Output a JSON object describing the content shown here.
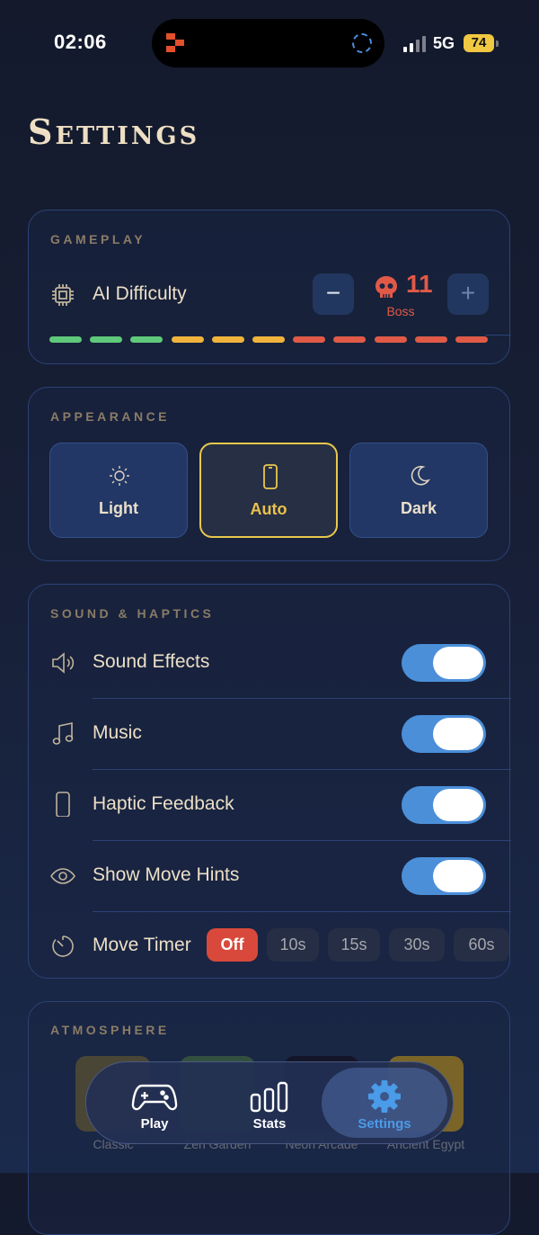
{
  "status_bar": {
    "time": "02:06",
    "network": "5G",
    "battery": "74"
  },
  "page": {
    "title": "Settings"
  },
  "gameplay": {
    "section_label": "GAMEPLAY",
    "ai_difficulty_label": "AI Difficulty",
    "minus_label": "−",
    "plus_label": "+",
    "value": "11",
    "tier": "Boss",
    "scale_colors": [
      "#5fc97b",
      "#5fc97b",
      "#5fc97b",
      "#f0b43c",
      "#f0b43c",
      "#f0b43c",
      "#e05a47",
      "#e05a47",
      "#e05a47",
      "#e05a47",
      "#e05a47"
    ]
  },
  "appearance": {
    "section_label": "APPEARANCE",
    "options": [
      {
        "label": "Light",
        "icon": "sun-icon",
        "selected": false
      },
      {
        "label": "Auto",
        "icon": "phone-icon",
        "selected": true
      },
      {
        "label": "Dark",
        "icon": "moon-icon",
        "selected": false
      }
    ]
  },
  "sound": {
    "section_label": "SOUND & HAPTICS",
    "rows": [
      {
        "label": "Sound Effects",
        "icon": "speaker-icon",
        "on": true
      },
      {
        "label": "Music",
        "icon": "music-note-icon",
        "on": true
      },
      {
        "label": "Haptic Feedback",
        "icon": "phone-vibrate-icon",
        "on": true
      },
      {
        "label": "Show Move Hints",
        "icon": "eye-icon",
        "on": true
      }
    ],
    "move_timer": {
      "label": "Move Timer",
      "icon": "timer-icon",
      "options": [
        "Off",
        "10s",
        "15s",
        "30s",
        "60s"
      ],
      "selected": "Off"
    }
  },
  "atmosphere": {
    "section_label": "ATMOSPHERE",
    "themes": [
      "Classic",
      "Zen Garden",
      "Neon Arcade",
      "Ancient Egypt"
    ]
  },
  "nav": {
    "items": [
      {
        "label": "Play",
        "icon": "gamepad-icon"
      },
      {
        "label": "Stats",
        "icon": "bar-chart-icon"
      },
      {
        "label": "Settings",
        "icon": "gear-icon",
        "active": true
      }
    ]
  },
  "colors": {
    "accent": "#4a9be8",
    "danger": "#e05a47",
    "gold": "#e9c84c",
    "toggle_on": "#4b8fd9"
  }
}
